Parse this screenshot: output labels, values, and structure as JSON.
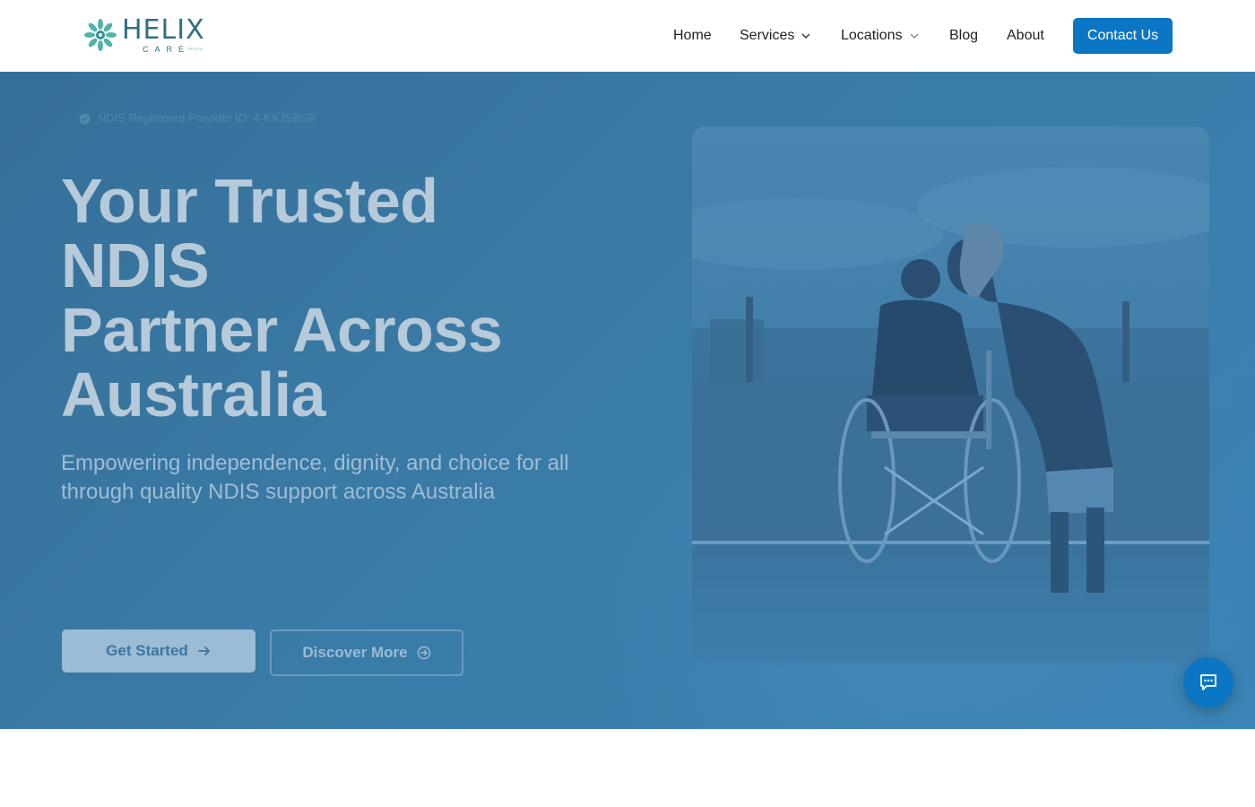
{
  "brand": {
    "name": "HELIX",
    "sub": "CARE",
    "tm": "PTY LTD",
    "primary_color": "#0b76c3",
    "logo_color": "#2f6f83",
    "logo_accent": "#4fb3ad"
  },
  "nav": {
    "items": [
      {
        "label": "Home",
        "has_dropdown": false
      },
      {
        "label": "Services",
        "has_dropdown": true
      },
      {
        "label": "Locations",
        "has_dropdown": true
      },
      {
        "label": "Blog",
        "has_dropdown": false
      },
      {
        "label": "About",
        "has_dropdown": false
      }
    ],
    "contact_label": "Contact Us"
  },
  "hero": {
    "badge": "NDIS Registered Provider ID: 4-KXJSBSR",
    "title_lines": [
      "Your Trusted",
      "NDIS",
      "Partner Across",
      "Australia"
    ],
    "subtitle": "Empowering independence, dignity, and choice for all through quality NDIS support across Australia",
    "primary_cta": "Get Started",
    "secondary_cta": "Discover More",
    "overlay_color": "#3a7aa5"
  },
  "icons": {
    "chevron": "chevron-down-icon",
    "badge": "check-circle-icon",
    "arrow": "arrow-right-icon",
    "circle_arrow": "circle-arrow-right-icon",
    "chat": "chat-icon"
  }
}
